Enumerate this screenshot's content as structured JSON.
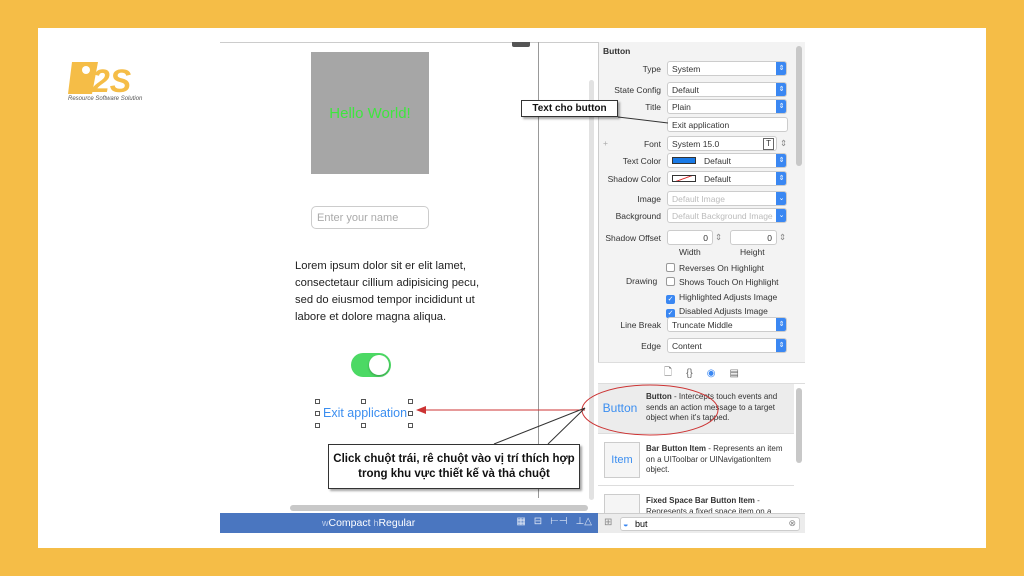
{
  "logo": {
    "brand": "R2S",
    "tagline": "Resource Software Solution"
  },
  "canvas": {
    "label_text": "Hello World!",
    "name_placeholder": "Enter your name",
    "lorem": "Lorem ipsum dolor sit er elit lamet, consectetaur cillium adipisicing pecu, sed do eiusmod tempor incididunt ut labore et dolore magna aliqua.",
    "toggle_on": true,
    "button_title": "Exit application",
    "size_class": {
      "w_prefix": "w",
      "w": "Compact",
      "h_prefix": "h",
      "h": "Regular"
    }
  },
  "inspector": {
    "section": "Button",
    "rows": [
      {
        "label": "Type",
        "value": "System"
      },
      {
        "label": "State Config",
        "value": "Default"
      },
      {
        "label": "Title",
        "value": "Plain"
      },
      {
        "label": "",
        "value": "Exit application"
      },
      {
        "label": "Font",
        "value": "System 15.0"
      },
      {
        "label": "Text Color",
        "value": "Default"
      },
      {
        "label": "Shadow Color",
        "value": "Default"
      },
      {
        "label": "Image",
        "value": "Default Image"
      },
      {
        "label": "Background",
        "value": "Default Background Image"
      }
    ],
    "shadow_offset": {
      "label": "Shadow Offset",
      "width": "0",
      "height": "0",
      "width_label": "Width",
      "height_label": "Height"
    },
    "drawing_label": "Drawing",
    "checkboxes": [
      {
        "label": "Reverses On Highlight",
        "checked": false
      },
      {
        "label": "Shows Touch On Highlight",
        "checked": false
      },
      {
        "label": "Highlighted Adjusts Image",
        "checked": true
      },
      {
        "label": "Disabled Adjusts Image",
        "checked": true
      }
    ],
    "line_break": {
      "label": "Line Break",
      "value": "Truncate Middle"
    },
    "edge": {
      "label": "Edge",
      "value": "Content"
    },
    "text_color_hex": "#1a7ae6"
  },
  "library": {
    "items": [
      {
        "thumb": "Button",
        "name": "Button",
        "desc": " - Intercepts touch events and sends an action message to a target object when it's tapped."
      },
      {
        "thumb": "Item",
        "name": "Bar Button Item",
        "desc": " - Represents an item on a UIToolbar or UINavigationItem object."
      },
      {
        "thumb": "",
        "name": "Fixed Space Bar Button Item",
        "desc": " - Represents a fixed space item on a"
      }
    ],
    "search": "but"
  },
  "annotations": {
    "title_callout": "Text cho button",
    "drag_callout": "Click chuột trái, rê chuột vào vị trí thích hợp trong khu vực thiết kế và thả chuột"
  }
}
